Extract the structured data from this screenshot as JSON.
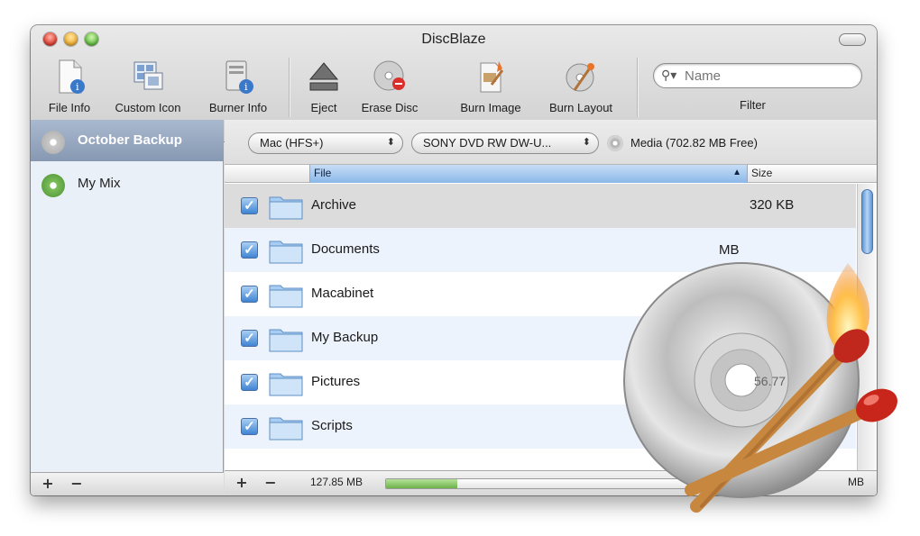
{
  "window": {
    "title": "DiscBlaze"
  },
  "toolbar": {
    "items": [
      {
        "label": "File Info",
        "icon": "file-info-icon"
      },
      {
        "label": "Custom Icon",
        "icon": "custom-icon-icon"
      },
      {
        "label": "Burner Info",
        "icon": "burner-info-icon"
      },
      {
        "label": "Eject",
        "icon": "eject-icon"
      },
      {
        "label": "Erase Disc",
        "icon": "erase-disc-icon"
      },
      {
        "label": "Burn Image",
        "icon": "burn-image-icon"
      },
      {
        "label": "Burn Layout",
        "icon": "burn-layout-icon"
      }
    ],
    "search": {
      "placeholder": "Name",
      "value": ""
    },
    "filter_label": "Filter"
  },
  "sidebar": {
    "items": [
      {
        "label": "October Backup",
        "selected": true
      },
      {
        "label": "My Mix",
        "selected": false
      }
    ],
    "add_label": "+",
    "remove_label": "−"
  },
  "options": {
    "format": "Mac (HFS+)",
    "drive": "SONY DVD RW DW-U...",
    "media": "Media (702.82 MB Free)"
  },
  "table": {
    "columns": [
      "File",
      "Size"
    ],
    "rows": [
      {
        "name": "Archive",
        "size": "320 KB",
        "checked": true
      },
      {
        "name": "Documents",
        "size": "",
        "checked": true
      },
      {
        "name": "Macabinet",
        "size": "",
        "checked": true
      },
      {
        "name": "My Backup",
        "size": "",
        "checked": true
      },
      {
        "name": "Pictures",
        "size": "",
        "checked": true
      },
      {
        "name": "Scripts",
        "size": "",
        "checked": true
      }
    ]
  },
  "footer": {
    "add_label": "+",
    "remove_label": "−",
    "used": "127.85 MB",
    "progress": 0.19,
    "capacity": "MB"
  },
  "artwork": {
    "hidden_size": "MB",
    "disc_label": "56.77"
  },
  "colors": {
    "accent": "#3f84d3",
    "selection": "#8798b2",
    "progress": "#6db24a"
  }
}
